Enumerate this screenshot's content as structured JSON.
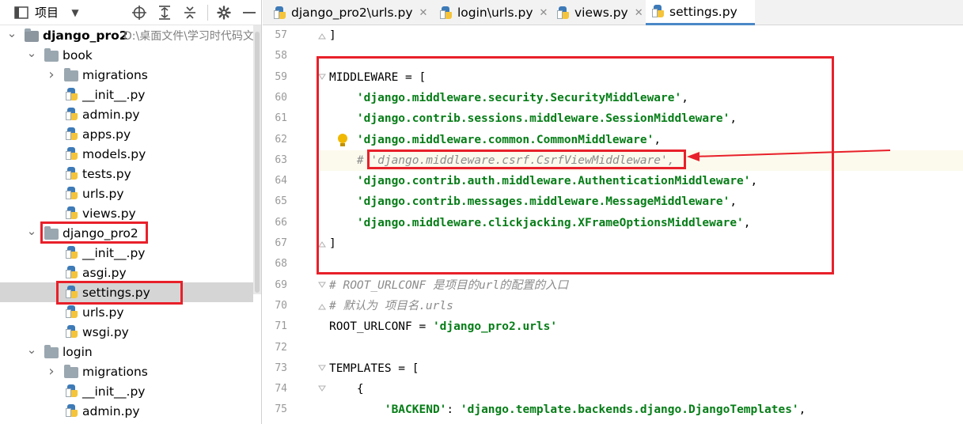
{
  "panel": {
    "title": "项目",
    "header_icons": [
      "locate-icon",
      "expand-all-icon",
      "collapse-all-icon",
      "gear-icon",
      "minimize-icon"
    ]
  },
  "tree": [
    {
      "label": "django_pro2",
      "path": "D:\\桌面文件\\学习时代码文",
      "type": "root",
      "depth": 0,
      "expanded": true
    },
    {
      "label": "book",
      "type": "folder",
      "depth": 1,
      "expanded": true
    },
    {
      "label": "migrations",
      "type": "folder",
      "depth": 2,
      "expanded": false
    },
    {
      "label": "__init__.py",
      "type": "py",
      "depth": 2
    },
    {
      "label": "admin.py",
      "type": "py",
      "depth": 2
    },
    {
      "label": "apps.py",
      "type": "py",
      "depth": 2
    },
    {
      "label": "models.py",
      "type": "py",
      "depth": 2
    },
    {
      "label": "tests.py",
      "type": "py",
      "depth": 2
    },
    {
      "label": "urls.py",
      "type": "py",
      "depth": 2
    },
    {
      "label": "views.py",
      "type": "py",
      "depth": 2
    },
    {
      "label": "django_pro2",
      "type": "folder",
      "depth": 1,
      "expanded": true
    },
    {
      "label": "__init__.py",
      "type": "py",
      "depth": 2
    },
    {
      "label": "asgi.py",
      "type": "py",
      "depth": 2
    },
    {
      "label": "settings.py",
      "type": "py",
      "depth": 2,
      "selected": true
    },
    {
      "label": "urls.py",
      "type": "py",
      "depth": 2
    },
    {
      "label": "wsgi.py",
      "type": "py",
      "depth": 2
    },
    {
      "label": "login",
      "type": "folder",
      "depth": 1,
      "expanded": true
    },
    {
      "label": "migrations",
      "type": "folder",
      "depth": 2,
      "expanded": false
    },
    {
      "label": "__init__.py",
      "type": "py",
      "depth": 2
    },
    {
      "label": "admin.py",
      "type": "py",
      "depth": 2
    }
  ],
  "tabs": [
    {
      "label": "django_pro2\\urls.py",
      "active": false
    },
    {
      "label": "login\\urls.py",
      "active": false
    },
    {
      "label": "views.py",
      "active": false
    },
    {
      "label": "settings.py",
      "active": true
    }
  ],
  "code": [
    {
      "num": "57",
      "parts": [
        {
          "t": "]",
          "c": "k"
        }
      ],
      "fold": "end"
    },
    {
      "num": "58",
      "parts": []
    },
    {
      "num": "59",
      "parts": [
        {
          "t": "MIDDLEWARE = [",
          "c": "k"
        }
      ],
      "fold": "start"
    },
    {
      "num": "60",
      "parts": [
        {
          "t": "    ",
          "c": "k"
        },
        {
          "t": "'django.middleware.security.SecurityMiddleware'",
          "c": "s"
        },
        {
          "t": ",",
          "c": "k"
        }
      ]
    },
    {
      "num": "61",
      "parts": [
        {
          "t": "    ",
          "c": "k"
        },
        {
          "t": "'django.contrib.sessions.middleware.SessionMiddleware'",
          "c": "s"
        },
        {
          "t": ",",
          "c": "k"
        }
      ]
    },
    {
      "num": "62",
      "parts": [
        {
          "t": "    ",
          "c": "k"
        },
        {
          "t": "'django.middleware.common.CommonMiddleware'",
          "c": "s"
        },
        {
          "t": ",",
          "c": "k"
        }
      ],
      "bulb": true
    },
    {
      "num": "63",
      "parts": [
        {
          "t": "    ",
          "c": "k"
        },
        {
          "t": "# 'django.middleware.csrf.CsrfViewMiddleware',",
          "c": "com"
        }
      ],
      "highlight": true
    },
    {
      "num": "64",
      "parts": [
        {
          "t": "    ",
          "c": "k"
        },
        {
          "t": "'django.contrib.auth.middleware.AuthenticationMiddleware'",
          "c": "s"
        },
        {
          "t": ",",
          "c": "k"
        }
      ]
    },
    {
      "num": "65",
      "parts": [
        {
          "t": "    ",
          "c": "k"
        },
        {
          "t": "'django.contrib.messages.middleware.MessageMiddleware'",
          "c": "s"
        },
        {
          "t": ",",
          "c": "k"
        }
      ]
    },
    {
      "num": "66",
      "parts": [
        {
          "t": "    ",
          "c": "k"
        },
        {
          "t": "'django.middleware.clickjacking.XFrameOptionsMiddleware'",
          "c": "s"
        },
        {
          "t": ",",
          "c": "k"
        }
      ]
    },
    {
      "num": "67",
      "parts": [
        {
          "t": "]",
          "c": "k"
        }
      ],
      "fold": "end"
    },
    {
      "num": "68",
      "parts": []
    },
    {
      "num": "69",
      "parts": [
        {
          "t": "# ROOT_URLCONF 是项目的url的配置的入口",
          "c": "com"
        }
      ],
      "fold": "start"
    },
    {
      "num": "70",
      "parts": [
        {
          "t": "# 默认为 项目名.urls",
          "c": "com"
        }
      ],
      "fold": "end"
    },
    {
      "num": "71",
      "parts": [
        {
          "t": "ROOT_URLCONF = ",
          "c": "k"
        },
        {
          "t": "'django_pro2.urls'",
          "c": "s"
        }
      ]
    },
    {
      "num": "72",
      "parts": []
    },
    {
      "num": "73",
      "parts": [
        {
          "t": "TEMPLATES = [",
          "c": "k"
        }
      ],
      "fold": "start"
    },
    {
      "num": "74",
      "parts": [
        {
          "t": "    {",
          "c": "k"
        }
      ],
      "fold": "start"
    },
    {
      "num": "75",
      "parts": [
        {
          "t": "        ",
          "c": "k"
        },
        {
          "t": "'BACKEND'",
          "c": "s"
        },
        {
          "t": ": ",
          "c": "k"
        },
        {
          "t": "'django.template.backends.django.DjangoTemplates'",
          "c": "s"
        },
        {
          "t": ",",
          "c": "k"
        }
      ]
    }
  ],
  "colors": {
    "annotation_red": "#e8202a",
    "string_green": "#067d17",
    "comment_gray": "#8c8c8c",
    "tab_active_underline": "#4a88c7"
  }
}
